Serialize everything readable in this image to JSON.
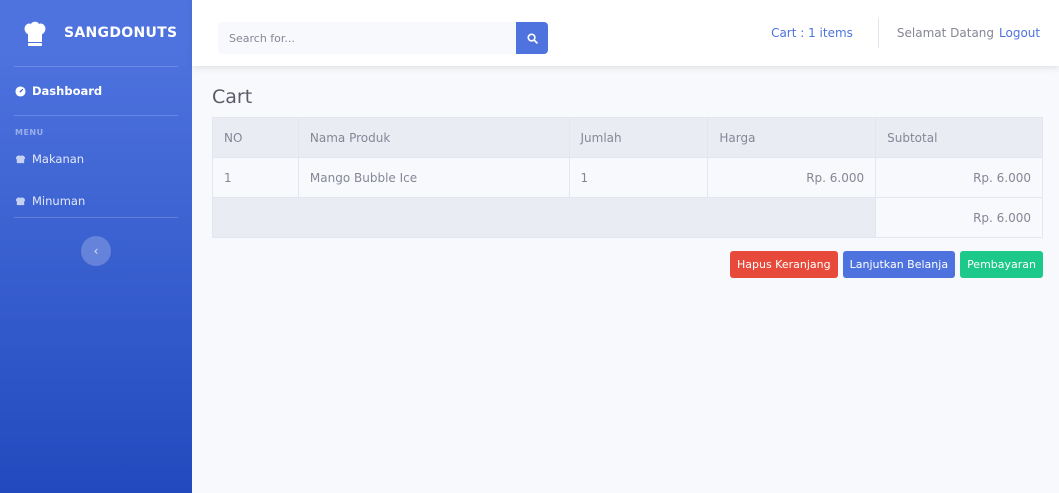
{
  "brand": {
    "name": "SANGDONUTS"
  },
  "sidebar": {
    "dashboard_label": "Dashboard",
    "heading": "MENU",
    "items": [
      {
        "label": "Makanan"
      },
      {
        "label": "Minuman"
      }
    ]
  },
  "topbar": {
    "search_placeholder": "Search for...",
    "cart_label": "Cart : 1 items",
    "welcome": "Selamat Datang",
    "logout": "Logout"
  },
  "main": {
    "title": "Cart",
    "table": {
      "headers": [
        "NO",
        "Nama Produk",
        "Jumlah",
        "Harga",
        "Subtotal"
      ],
      "rows": [
        {
          "no": "1",
          "product": "Mango Bubble Ice",
          "qty": "1",
          "price": "Rp. 6.000",
          "subtotal": "Rp. 6.000"
        }
      ],
      "total": "Rp. 6.000"
    },
    "buttons": {
      "clear": "Hapus Keranjang",
      "continue": "Lanjutkan Belanja",
      "pay": "Pembayaran"
    }
  },
  "colors": {
    "primary": "#4e73df",
    "danger": "#e74a3b",
    "success": "#1cc88a"
  }
}
